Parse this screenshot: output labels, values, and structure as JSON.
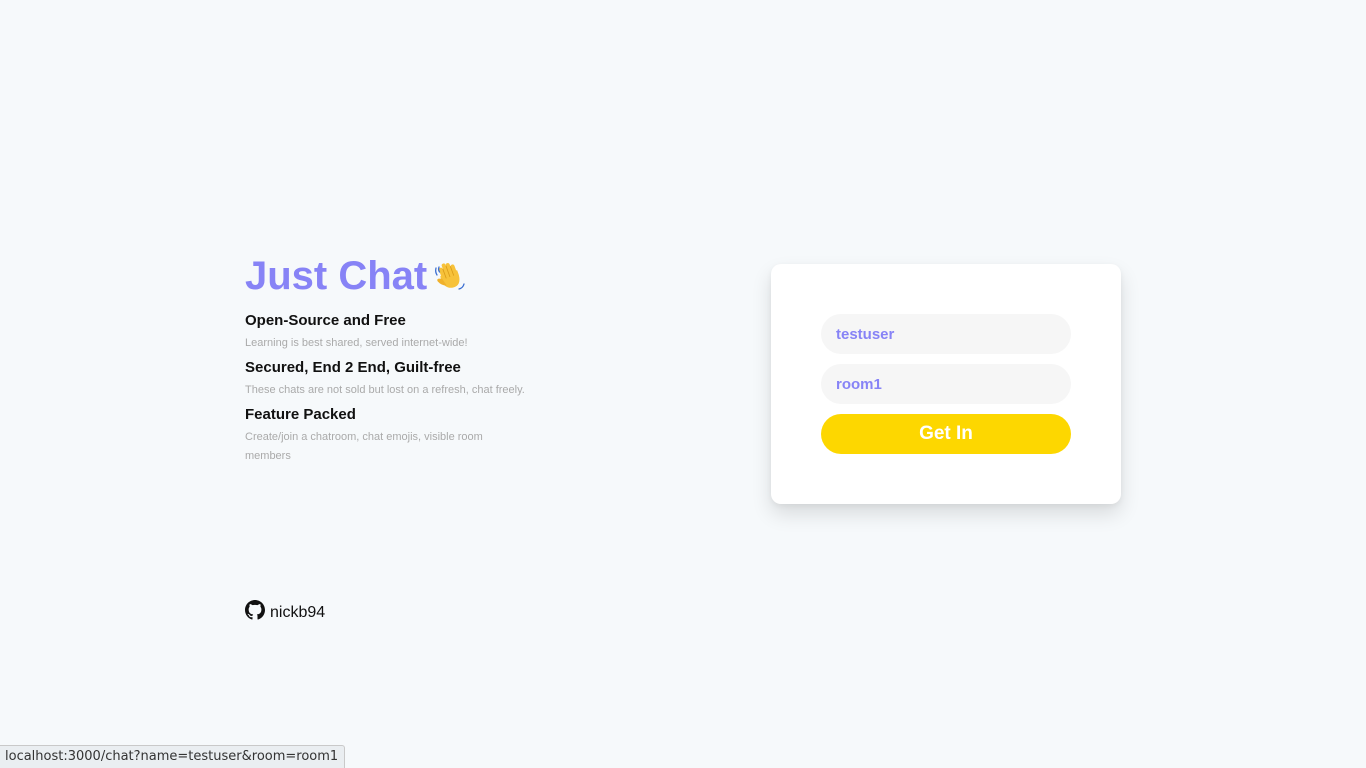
{
  "app": {
    "title": "Just Chat",
    "title_emoji": "waving-hand-icon"
  },
  "features": [
    {
      "heading": "Open-Source and Free",
      "description": "Learning is best shared, served internet-wide!"
    },
    {
      "heading": "Secured, End 2 End, Guilt-free",
      "description": "These chats are not sold but lost on a refresh, chat freely."
    },
    {
      "heading": "Feature Packed",
      "description": "Create/join a chatroom, chat emojis, visible room members"
    }
  ],
  "form": {
    "name_value": "testuser",
    "room_value": "room1",
    "submit_label": "Get In"
  },
  "footer": {
    "icon": "github-icon",
    "username": "nickb94"
  },
  "status_bar": {
    "url": "localhost:3000/chat?name=testuser&room=room1"
  },
  "colors": {
    "accent": "#8783f6",
    "button": "#fdd700",
    "background": "#f6f9fb"
  }
}
